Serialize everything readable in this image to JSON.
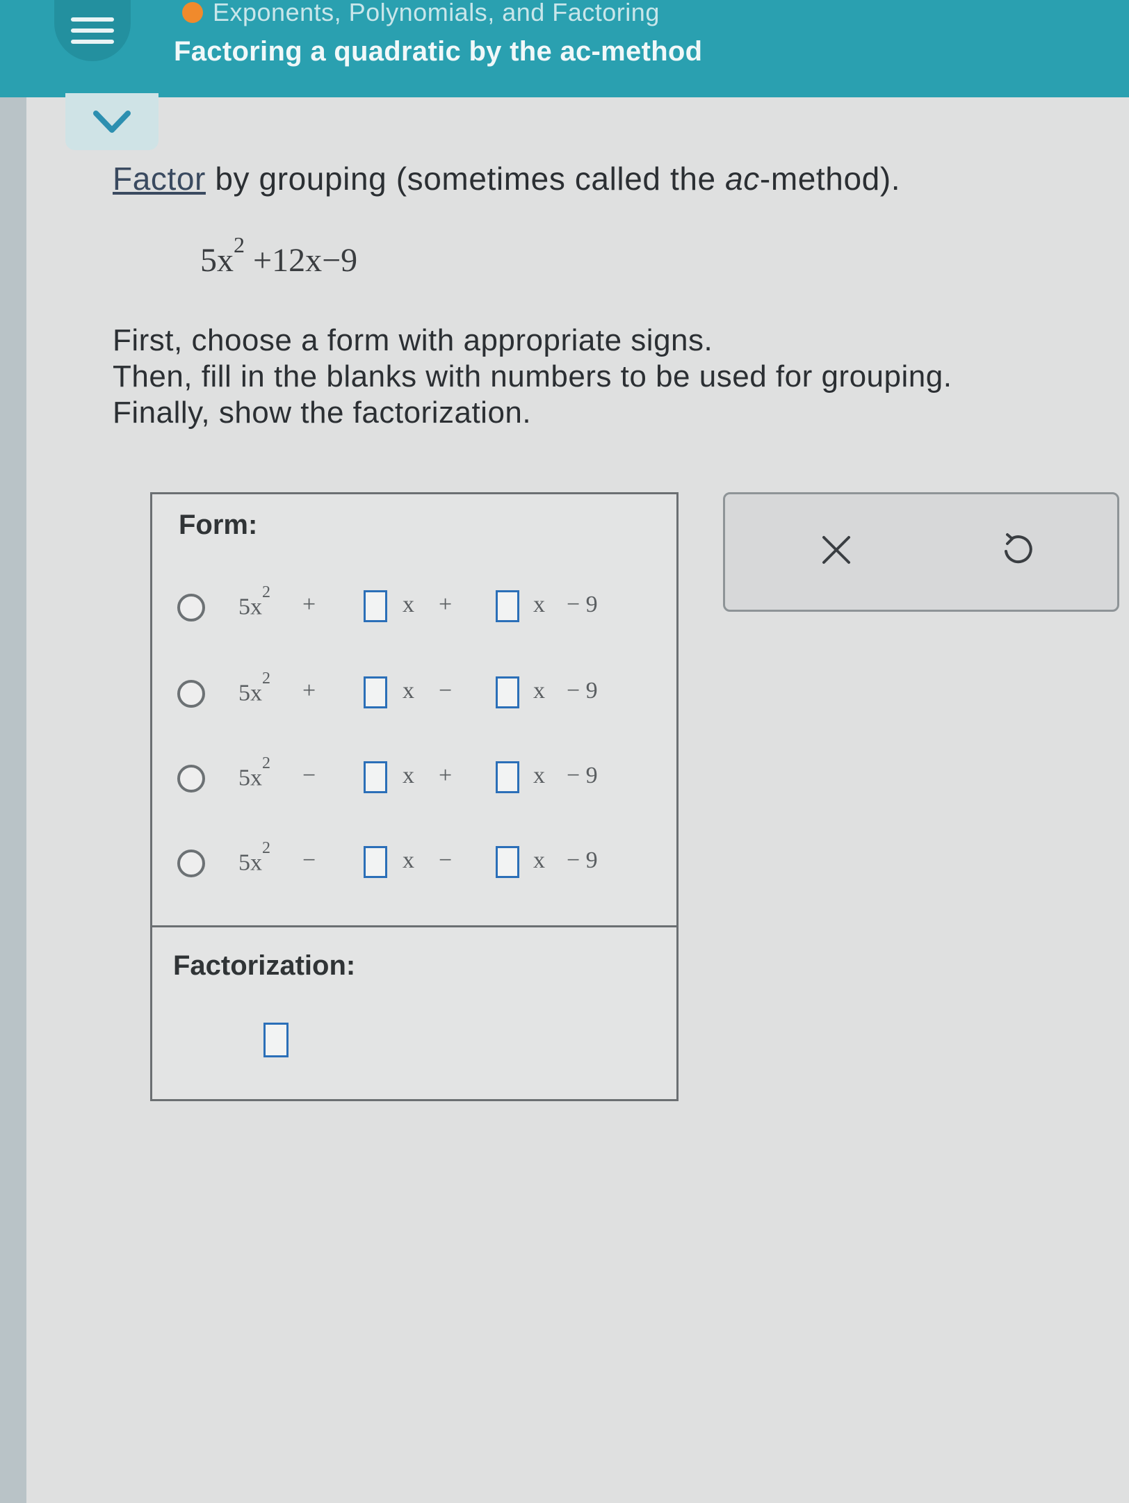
{
  "header": {
    "topic": "Exponents, Polynomials, and Factoring",
    "title": "Factoring a quadratic by the ac-method",
    "menu_icon": "hamburger-icon",
    "topic_status_color": "#f08a2c",
    "accent_color": "#2aa0b0"
  },
  "collapse": {
    "icon": "chevron-down-icon"
  },
  "question": {
    "link_text": "Factor",
    "text_before_ac": " by grouping (sometimes called the ",
    "ac": "ac",
    "text_after_ac": "-method).",
    "expression": {
      "coef": "5x",
      "exp": "2",
      "rest": " +12x−9"
    },
    "steps": [
      "First, choose a form with appropriate signs.",
      "Then, fill in the blanks with numbers to be used for grouping.",
      "Finally, show the factorization."
    ]
  },
  "answer": {
    "form_label": "Form:",
    "options": [
      {
        "lead": "5x",
        "exp": "2",
        "s1": "+",
        "var1": "x",
        "s2": "+",
        "var2": "x",
        "tail": "− 9"
      },
      {
        "lead": "5x",
        "exp": "2",
        "s1": "+",
        "var1": "x",
        "s2": "−",
        "var2": "x",
        "tail": "− 9"
      },
      {
        "lead": "5x",
        "exp": "2",
        "s1": "−",
        "var1": "x",
        "s2": "+",
        "var2": "x",
        "tail": "− 9"
      },
      {
        "lead": "5x",
        "exp": "2",
        "s1": "−",
        "var1": "x",
        "s2": "−",
        "var2": "x",
        "tail": "− 9"
      }
    ],
    "factorization_label": "Factorization:"
  },
  "actions": {
    "clear_icon": "close-icon",
    "undo_icon": "undo-icon"
  }
}
